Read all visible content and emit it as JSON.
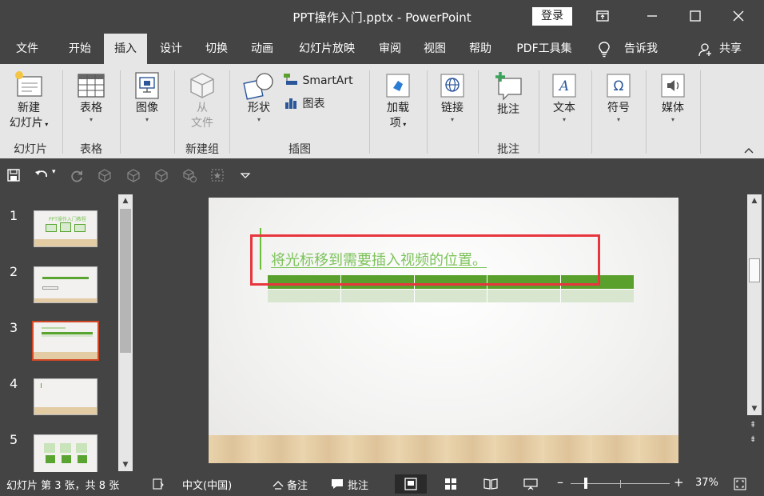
{
  "window": {
    "title": "PPT操作入门.pptx  -  PowerPoint",
    "login_label": "登录"
  },
  "menu": {
    "tabs": [
      "文件",
      "开始",
      "插入",
      "设计",
      "切换",
      "动画",
      "幻灯片放映",
      "审阅",
      "视图",
      "帮助",
      "PDF工具集"
    ],
    "active_tab": "插入",
    "tell_me": "告诉我",
    "share": "共享"
  },
  "ribbon": {
    "new_slide": [
      "新建",
      "幻灯片"
    ],
    "table": "表格",
    "image": "图像",
    "from_file": [
      "从",
      "文件"
    ],
    "shapes": "形状",
    "smartart": "SmartArt",
    "chart": "图表",
    "addins": [
      "加载",
      "项"
    ],
    "link": "链接",
    "comment": "批注",
    "text": "文本",
    "symbol": "符号",
    "media": "媒体",
    "groups": {
      "slides": "幻灯片",
      "tables": "表格",
      "new_group": "新建组",
      "illustrations": "插图",
      "comments": "批注"
    }
  },
  "slides_panel": {
    "numbers": [
      "1",
      "2",
      "3",
      "4",
      "5"
    ],
    "selected": "3",
    "thumb1_text": "PPT操作入门教程"
  },
  "slide": {
    "heading": "将光标移到需要插入视频的位置。",
    "table": {
      "columns": 5,
      "rows": 2
    }
  },
  "status": {
    "slide_info": "幻灯片 第 3 张，共 8 张",
    "language": "中文(中国)",
    "notes": "备注",
    "comments": "批注",
    "zoom": "37%",
    "zoom_level": 0.37
  },
  "colors": {
    "accent": "#d24726",
    "dark_bg": "#444444",
    "ribbon_bg": "#e6e6e6",
    "highlight_box": "#e8363e",
    "slide_text": "#7cc35a",
    "table_header": "#5aa02c"
  }
}
